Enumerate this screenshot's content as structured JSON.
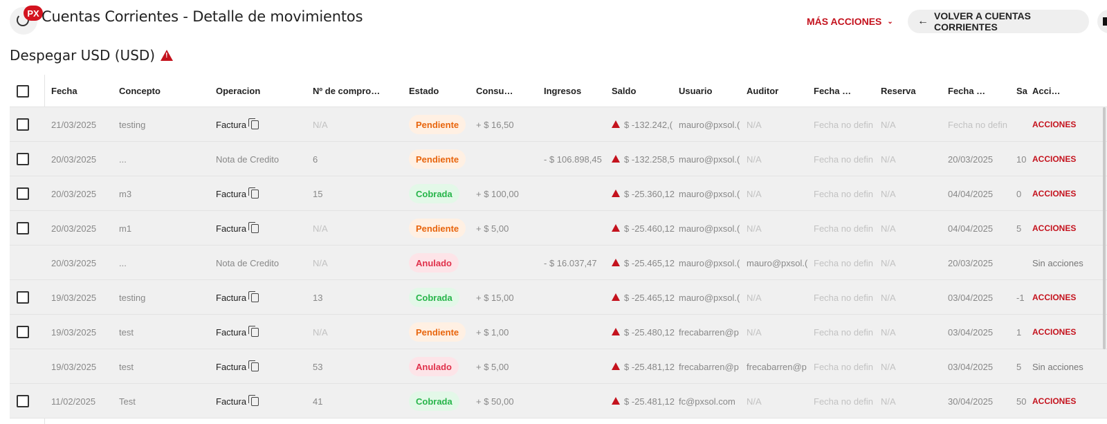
{
  "header": {
    "badge": "PX",
    "title": "Cuentas Corrientes - Detalle de movimientos",
    "more_actions": "MÁS ACCIONES",
    "back_button": "VOLVER A CUENTAS CORRIENTES"
  },
  "account": {
    "title": "Despegar USD (USD)"
  },
  "colors": {
    "accent": "#c4121d",
    "pendiente_text": "#e8650d",
    "pendiente_bg": "#fff0e3",
    "cobrada_text": "#27b54a",
    "cobrada_bg": "#e3f8e8",
    "anulado_text": "#e0314b",
    "anulado_bg": "#fde4e8"
  },
  "table": {
    "columns": [
      "Fecha",
      "Concepto",
      "Operacion",
      "Nº de compro…",
      "Estado",
      "Consu…",
      "Ingresos",
      "Saldo",
      "Usuario",
      "Auditor",
      "Fecha …",
      "Reserva",
      "Fecha …",
      "Sa",
      "Acci…"
    ],
    "rows": [
      {
        "checkbox": true,
        "fecha": "21/03/2025",
        "concepto": "testing",
        "operacion": "Factura",
        "copy": true,
        "comprobante": "N/A",
        "estado": "Pendiente",
        "consumos": "+ $ 16,50",
        "ingresos": "",
        "saldo": "$ -132.242,(",
        "usuario": "mauro@pxsol.(",
        "auditor": "N/A",
        "fecha2": "Fecha no defin",
        "reserva": "N/A",
        "fecha3": "Fecha no defin",
        "sa": "",
        "acciones": "ACCIONES"
      },
      {
        "checkbox": true,
        "fecha": "20/03/2025",
        "concepto": "...",
        "operacion": "Nota de Credito",
        "copy": false,
        "comprobante": "6",
        "estado": "Pendiente",
        "consumos": "",
        "ingresos": "- $ 106.898,45",
        "saldo": "$ -132.258,5",
        "usuario": "mauro@pxsol.(",
        "auditor": "N/A",
        "fecha2": "Fecha no defin",
        "reserva": "N/A",
        "fecha3": "20/03/2025",
        "sa": "10",
        "acciones": "ACCIONES"
      },
      {
        "checkbox": true,
        "fecha": "20/03/2025",
        "concepto": "m3",
        "operacion": "Factura",
        "copy": true,
        "comprobante": "15",
        "estado": "Cobrada",
        "consumos": "+ $ 100,00",
        "ingresos": "",
        "saldo": "$ -25.360,12",
        "usuario": "mauro@pxsol.(",
        "auditor": "N/A",
        "fecha2": "Fecha no defin",
        "reserva": "N/A",
        "fecha3": "04/04/2025",
        "sa": "0",
        "acciones": "ACCIONES"
      },
      {
        "checkbox": true,
        "fecha": "20/03/2025",
        "concepto": "m1",
        "operacion": "Factura",
        "copy": true,
        "comprobante": "N/A",
        "estado": "Pendiente",
        "consumos": "+ $ 5,00",
        "ingresos": "",
        "saldo": "$ -25.460,12",
        "usuario": "mauro@pxsol.(",
        "auditor": "N/A",
        "fecha2": "Fecha no defin",
        "reserva": "N/A",
        "fecha3": "04/04/2025",
        "sa": "5",
        "acciones": "ACCIONES"
      },
      {
        "checkbox": false,
        "fecha": "20/03/2025",
        "concepto": "...",
        "operacion": "Nota de Credito",
        "copy": false,
        "comprobante": "N/A",
        "estado": "Anulado",
        "consumos": "",
        "ingresos": "- $ 16.037,47",
        "saldo": "$ -25.465,12",
        "usuario": "mauro@pxsol.(",
        "auditor": "mauro@pxsol.(",
        "fecha2": "Fecha no defin",
        "reserva": "N/A",
        "fecha3": "20/03/2025",
        "sa": "",
        "acciones": "Sin acciones"
      },
      {
        "checkbox": true,
        "fecha": "19/03/2025",
        "concepto": "testing",
        "operacion": "Factura",
        "copy": true,
        "comprobante": "13",
        "estado": "Cobrada",
        "consumos": "+ $ 15,00",
        "ingresos": "",
        "saldo": "$ -25.465,12",
        "usuario": "mauro@pxsol.(",
        "auditor": "N/A",
        "fecha2": "Fecha no defin",
        "reserva": "N/A",
        "fecha3": "03/04/2025",
        "sa": "-1",
        "acciones": "ACCIONES"
      },
      {
        "checkbox": true,
        "fecha": "19/03/2025",
        "concepto": "test",
        "operacion": "Factura",
        "copy": true,
        "comprobante": "N/A",
        "estado": "Pendiente",
        "consumos": "+ $ 1,00",
        "ingresos": "",
        "saldo": "$ -25.480,12",
        "usuario": "frecabarren@p",
        "auditor": "N/A",
        "fecha2": "Fecha no defin",
        "reserva": "N/A",
        "fecha3": "03/04/2025",
        "sa": "1",
        "acciones": "ACCIONES"
      },
      {
        "checkbox": false,
        "fecha": "19/03/2025",
        "concepto": "test",
        "operacion": "Factura",
        "copy": true,
        "comprobante": "53",
        "estado": "Anulado",
        "consumos": "+ $ 5,00",
        "ingresos": "",
        "saldo": "$ -25.481,12",
        "usuario": "frecabarren@p",
        "auditor": "frecabarren@p",
        "fecha2": "Fecha no defin",
        "reserva": "N/A",
        "fecha3": "03/04/2025",
        "sa": "5",
        "acciones": "Sin acciones"
      },
      {
        "checkbox": true,
        "fecha": "11/02/2025",
        "concepto": "Test",
        "operacion": "Factura",
        "copy": true,
        "comprobante": "41",
        "estado": "Cobrada",
        "consumos": "+ $ 50,00",
        "ingresos": "",
        "saldo": "$ -25.481,12",
        "usuario": "fc@pxsol.com",
        "auditor": "N/A",
        "fecha2": "Fecha no defin",
        "reserva": "N/A",
        "fecha3": "30/04/2025",
        "sa": "50",
        "acciones": "ACCIONES"
      }
    ]
  }
}
